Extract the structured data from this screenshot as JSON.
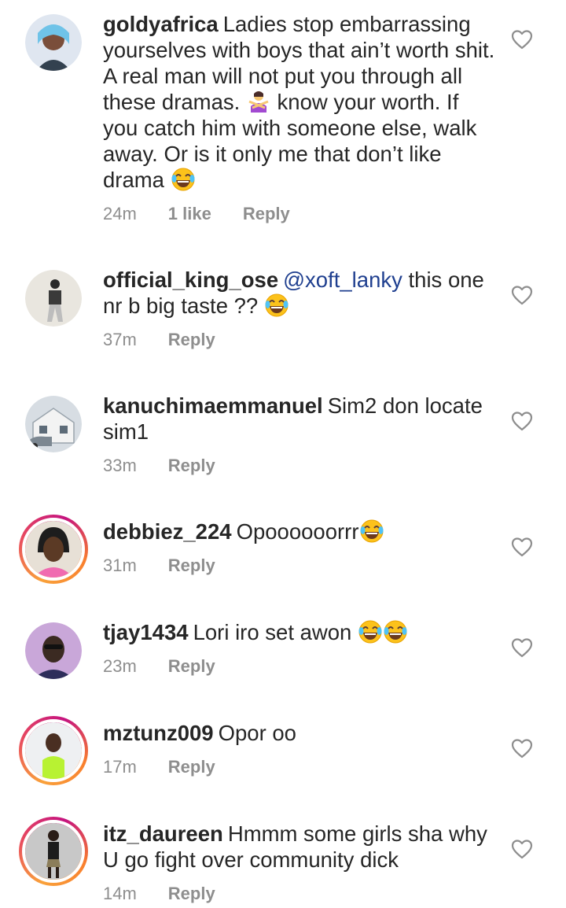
{
  "comments": [
    {
      "username": "goldyafrica",
      "text_parts": [
        "Ladies stop embarrassing yourselves with boys that ain’t worth shit. A real man will not put you through all these dramas. ",
        "know your worth. If you catch him with someone else, walk away. Or is it only me that don’t like drama "
      ],
      "time": "24m",
      "likes": "1 like",
      "reply": "Reply",
      "avatar_icon": "avatar-goldyafrica",
      "emojis": [
        "person-gesturing-no",
        "face-with-tears-of-joy"
      ]
    },
    {
      "username": "official_king_ose",
      "mention": "@xoft_lanky",
      "text": " this one nr b big taste ?? ",
      "time": "37m",
      "reply": "Reply",
      "avatar_icon": "avatar-official-king-ose",
      "emojis": [
        "face-with-tears-of-joy"
      ]
    },
    {
      "username": "kanuchimaemmanuel",
      "text": "Sim2 don locate sim1",
      "time": "33m",
      "reply": "Reply",
      "avatar_icon": "avatar-kanuchimaemmanuel"
    },
    {
      "username": "debbiez_224",
      "text": "Opoooooorrr",
      "time": "31m",
      "reply": "Reply",
      "avatar_icon": "avatar-debbiez",
      "emojis": [
        "face-with-tears-of-joy"
      ]
    },
    {
      "username": "tjay1434",
      "text": "Lori iro set awon ",
      "time": "23m",
      "reply": "Reply",
      "avatar_icon": "avatar-tjay1434",
      "emojis": [
        "face-with-tears-of-joy",
        "face-with-tears-of-joy"
      ]
    },
    {
      "username": "mztunz009",
      "text": "Opor oo",
      "time": "17m",
      "reply": "Reply",
      "avatar_icon": "avatar-mztunz009"
    },
    {
      "username": "itz_daureen",
      "text": "Hmmm some girls sha why U go fight over community dick",
      "time": "14m",
      "reply": "Reply",
      "avatar_icon": "avatar-itz-daureen"
    }
  ],
  "icons": {
    "like": "heart-outline-icon"
  },
  "colors": {
    "text": "#262626",
    "meta": "#8e8e8e",
    "mention": "#1f3f8f"
  }
}
